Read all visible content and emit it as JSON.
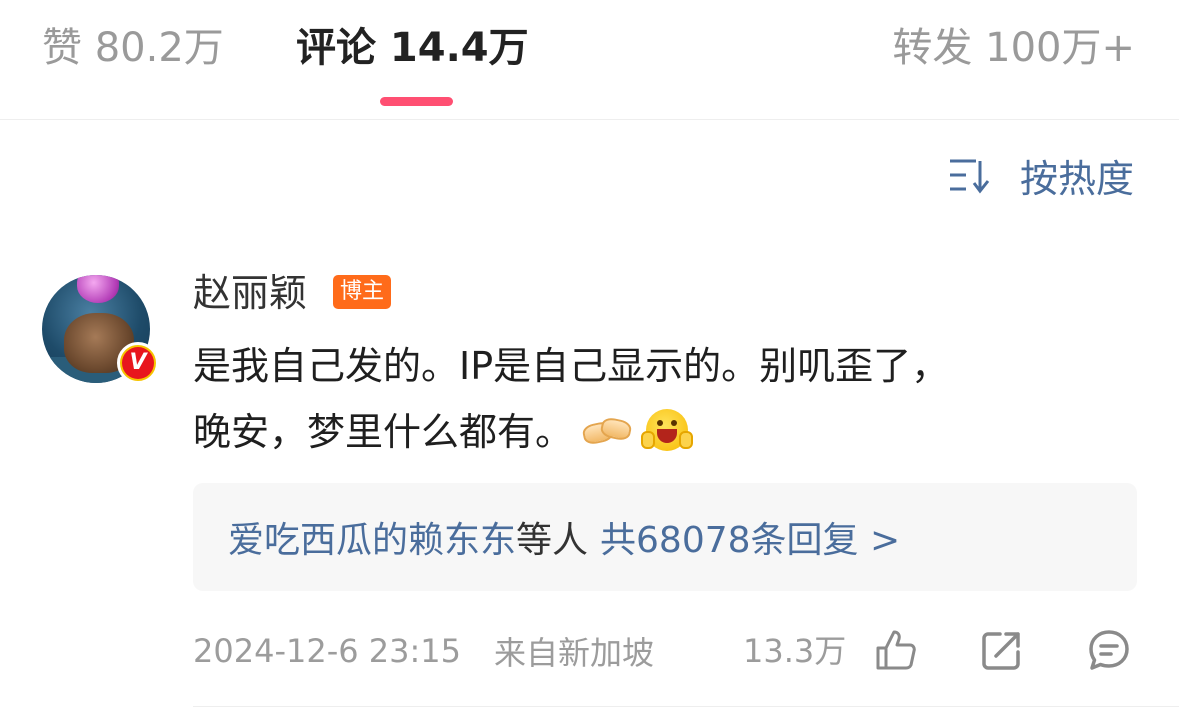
{
  "tabs": {
    "likes": "赞 80.2万",
    "comments": "评论 14.4万",
    "reposts": "转发 100万+",
    "accent": "#ff4f72"
  },
  "sort": {
    "label": "按热度",
    "icon": "sort-icon"
  },
  "comment": {
    "author": "赵丽颖",
    "author_tag": "博主",
    "verified_badge": "V",
    "text_line1": "是我自己发的。IP是自己显示的。别叽歪了，",
    "text_line2": "晚安，梦里什么都有。",
    "emojis": [
      "handshake-emoji",
      "grinning-face-emoji"
    ],
    "replies": {
      "names": "爱吃西瓜的赖东东",
      "joiner": "等人",
      "summary": "共68078条回复 >"
    },
    "timestamp": "2024-12-6 23:15",
    "location": "来自新加坡",
    "like_count": "13.3万"
  },
  "colors": {
    "link": "#4a6d9c",
    "author_tag_bg": "#ff6b1a",
    "badge_yellow": "#f6c400",
    "badge_red": "#e8161d"
  }
}
